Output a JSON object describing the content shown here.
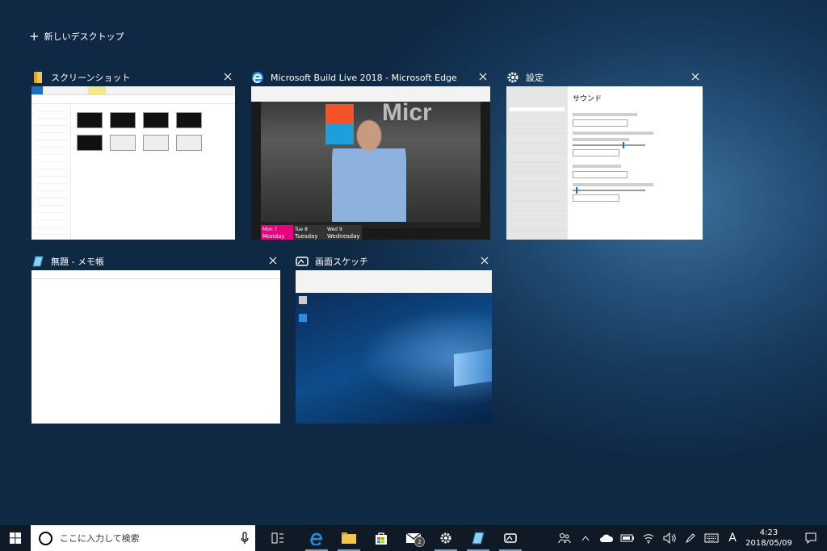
{
  "new_desktop_label": "新しいデスクトップ",
  "windows": [
    {
      "title": "スクリーンショット",
      "icon": "folder-icon"
    },
    {
      "title": "Microsoft Build Live 2018 - Microsoft Edge",
      "icon": "edge-icon"
    },
    {
      "title": "設定",
      "icon": "gear-icon"
    },
    {
      "title": "無題 - メモ帳",
      "icon": "notepad-icon"
    },
    {
      "title": "画面スケッチ",
      "icon": "sketch-icon"
    }
  ],
  "thumbs": {
    "settings_heading": "サウンド",
    "edge_days": [
      {
        "num": "Mon 7",
        "day": "Monday"
      },
      {
        "num": "Tue 8",
        "day": "Tuesday"
      },
      {
        "num": "Wed 9",
        "day": "Wednesday"
      }
    ],
    "edge_brand": "Micr"
  },
  "taskbar": {
    "search_placeholder": "ここに入力して検索",
    "mail_badge": "2",
    "ime": "A",
    "time": "4:23",
    "date": "2018/05/09"
  },
  "colors": {
    "accent": "#0078d7",
    "build_pink": "#e6007e",
    "taskbar": "#101a26"
  }
}
